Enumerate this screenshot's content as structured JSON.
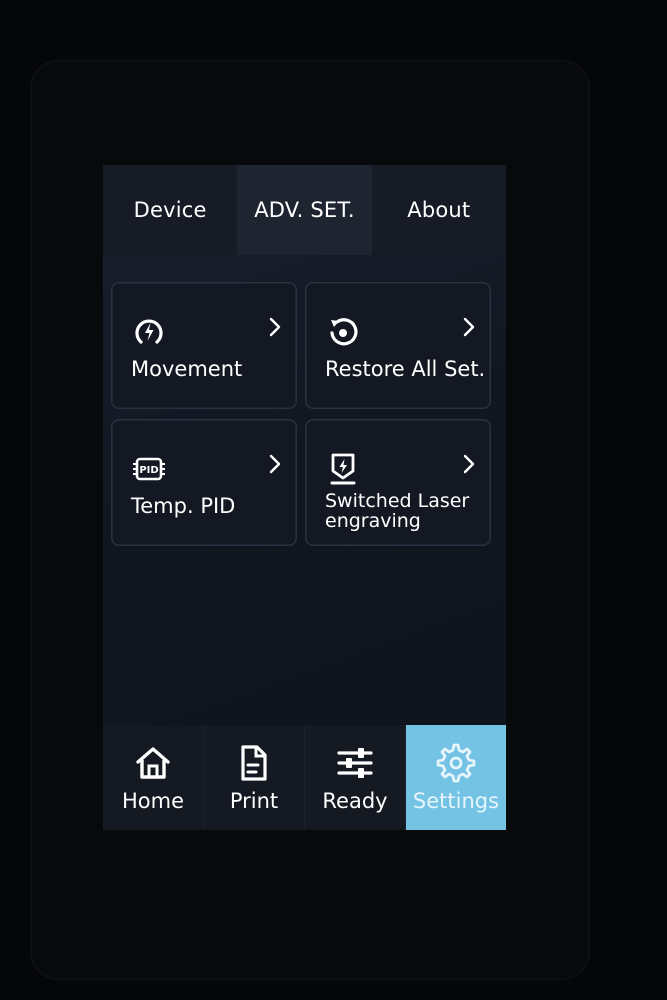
{
  "tabs": [
    {
      "label": "Device",
      "active": false
    },
    {
      "label": "ADV. SET.",
      "active": true
    },
    {
      "label": "About",
      "active": false
    }
  ],
  "cards": [
    {
      "label": "Movement",
      "icon": "movement-icon"
    },
    {
      "label": "Restore All Set.",
      "icon": "restore-icon"
    },
    {
      "label": "Temp. PID",
      "icon": "pid-chip-icon",
      "icon_text": "PID"
    },
    {
      "label_line1": "Switched Laser",
      "label_line2": "engraving",
      "icon": "laser-icon"
    }
  ],
  "nav": [
    {
      "label": "Home",
      "icon": "home-icon",
      "active": false
    },
    {
      "label": "Print",
      "icon": "file-icon",
      "active": false
    },
    {
      "label": "Ready",
      "icon": "sliders-icon",
      "active": false
    },
    {
      "label": "Settings",
      "icon": "gear-icon",
      "active": true
    }
  ],
  "colors": {
    "accent": "#74c2e4",
    "text": "#ffffff",
    "card_border": "#2a3140"
  }
}
